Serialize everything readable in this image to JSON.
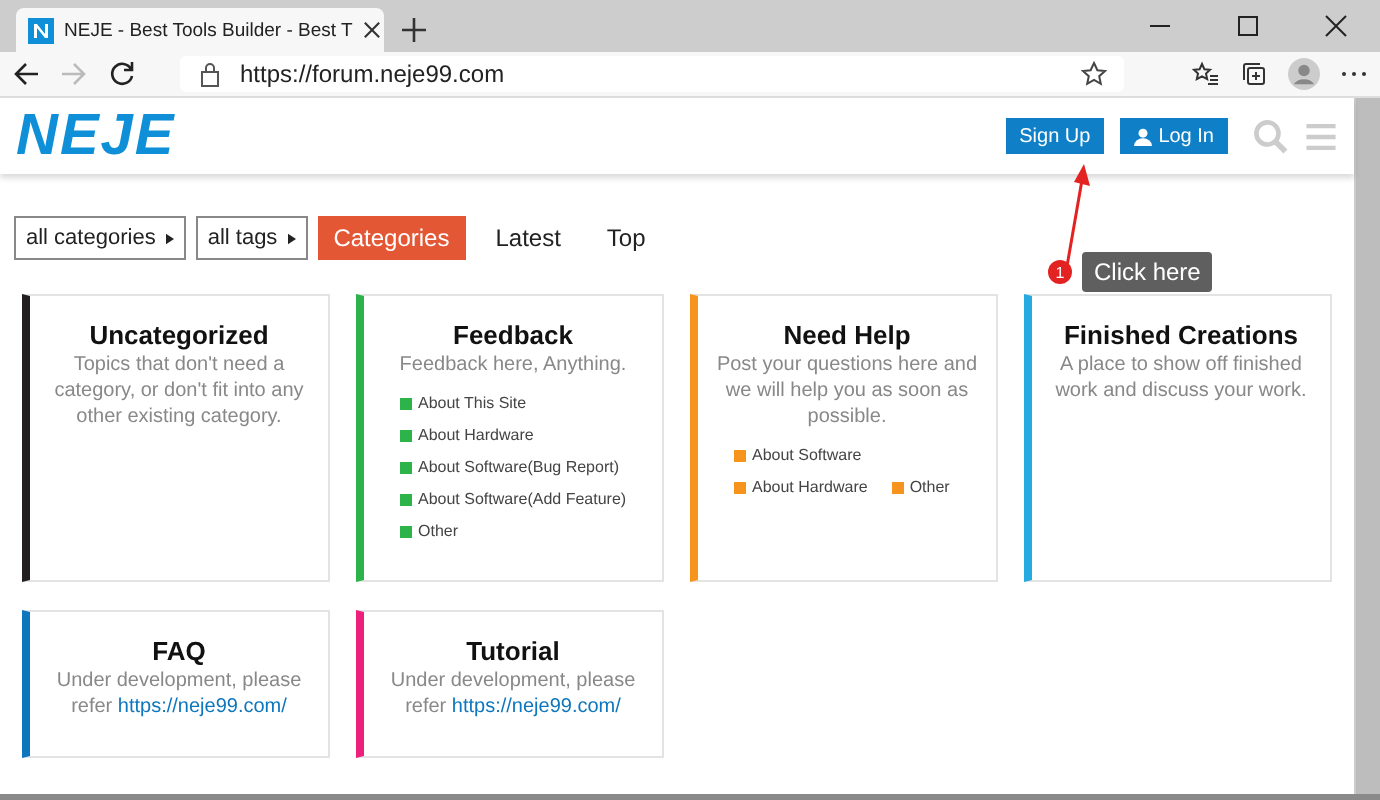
{
  "browser": {
    "tab_title": "NEJE - Best Tools Builder - Best T",
    "url": "https://forum.neje99.com",
    "forward_disabled": true
  },
  "header": {
    "logo": "NEJE",
    "sign_up": "Sign Up",
    "log_in": "Log In"
  },
  "annotation": {
    "number": "1",
    "label": "Click here"
  },
  "nav": {
    "filters": [
      "all categories",
      "all tags"
    ],
    "tabs": [
      {
        "label": "Categories",
        "selected": true
      },
      {
        "label": "Latest",
        "selected": false
      },
      {
        "label": "Top",
        "selected": false
      }
    ]
  },
  "categories": [
    {
      "name": "Uncategorized",
      "color": "#231f20",
      "description": "Topics that don't need a category, or don't fit into any other existing category."
    },
    {
      "name": "Feedback",
      "color": "#2cb34a",
      "description": "Feedback here, Anything.",
      "subcategory_rows": [
        [
          "About This Site"
        ],
        [
          "About Hardware"
        ],
        [
          "About Software(Bug Report)"
        ],
        [
          "About Software(Add Feature)"
        ],
        [
          "Other"
        ]
      ]
    },
    {
      "name": "Need Help",
      "color": "#f7941d",
      "description": "Post your questions here and we will help you as soon as possible.",
      "subcategory_rows": [
        [
          "About Software"
        ],
        [
          "About Hardware",
          "Other"
        ]
      ]
    },
    {
      "name": "Finished Creations",
      "color": "#25aae1",
      "description": "A place to show off finished work and discuss your work."
    },
    {
      "name": "FAQ",
      "color": "#0e76bd",
      "description": "Under development, please refer",
      "link": "https://neje99.com/"
    },
    {
      "name": "Tutorial",
      "color": "#ed207b",
      "description": "Under development, please refer",
      "link": "https://neje99.com/"
    }
  ]
}
